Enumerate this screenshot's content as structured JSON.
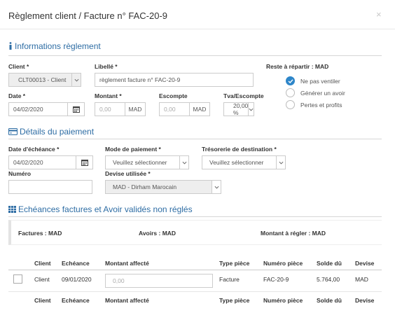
{
  "modal": {
    "title": "Règlement client / Facture n° FAC-20-9",
    "close_label": "×"
  },
  "info_section": {
    "title": "Informations règlement",
    "client_label": "Client *",
    "client_value": "CLT00013 - Client",
    "libelle_label": "Libellé *",
    "libelle_value": "règlement facture n° FAC-20-9",
    "reste_label": "Reste à répartir : MAD",
    "date_label": "Date *",
    "date_value": "04/02/2020",
    "montant_label": "Montant *",
    "montant_placeholder": "0,00",
    "montant_currency": "MAD",
    "escompte_label": "Escompte",
    "escompte_placeholder": "0,00",
    "escompte_currency": "MAD",
    "tva_label": "Tva/Escompte",
    "tva_value": "20,00 %",
    "radio_options": [
      {
        "label": "Ne pas ventiler",
        "selected": true
      },
      {
        "label": "Générer un avoir",
        "selected": false
      },
      {
        "label": "Pertes et profits",
        "selected": false
      }
    ]
  },
  "payment_section": {
    "title": "Détails du paiement",
    "echeance_label": "Date d'échéance *",
    "echeance_value": "04/02/2020",
    "mode_label": "Mode de paiement *",
    "mode_value": "Veuillez sélectionner",
    "tresorerie_label": "Trésorerie de destination *",
    "tresorerie_value": "Veuillez sélectionner",
    "numero_label": "Numéro",
    "numero_value": "",
    "devise_label": "Devise utilisée *",
    "devise_value": "MAD - Dirham Marocain"
  },
  "echeances_section": {
    "title": "Echéances factures et Avoir validés non réglés",
    "factures_total": "Factures : MAD",
    "avoirs_total": "Avoirs : MAD",
    "montant_regler": "Montant à régler : MAD",
    "columns": [
      "Client",
      "Echéance",
      "Montant affecté",
      "Type pièce",
      "Numéro pièce",
      "Solde dû",
      "Devise"
    ],
    "rows": [
      {
        "client": "Client",
        "echeance": "09/01/2020",
        "montant_placeholder": "0,00",
        "type": "Facture",
        "numero": "FAC-20-9",
        "solde": "5.764,00",
        "devise": "MAD"
      }
    ],
    "footer_columns": [
      "Client",
      "Echéance",
      "Montant affecté",
      "Type pièce",
      "Numéro pièce",
      "Solde dû",
      "Devise"
    ]
  },
  "colors": {
    "accent": "#2e6da4",
    "radio_selected": "#2e86c9"
  }
}
